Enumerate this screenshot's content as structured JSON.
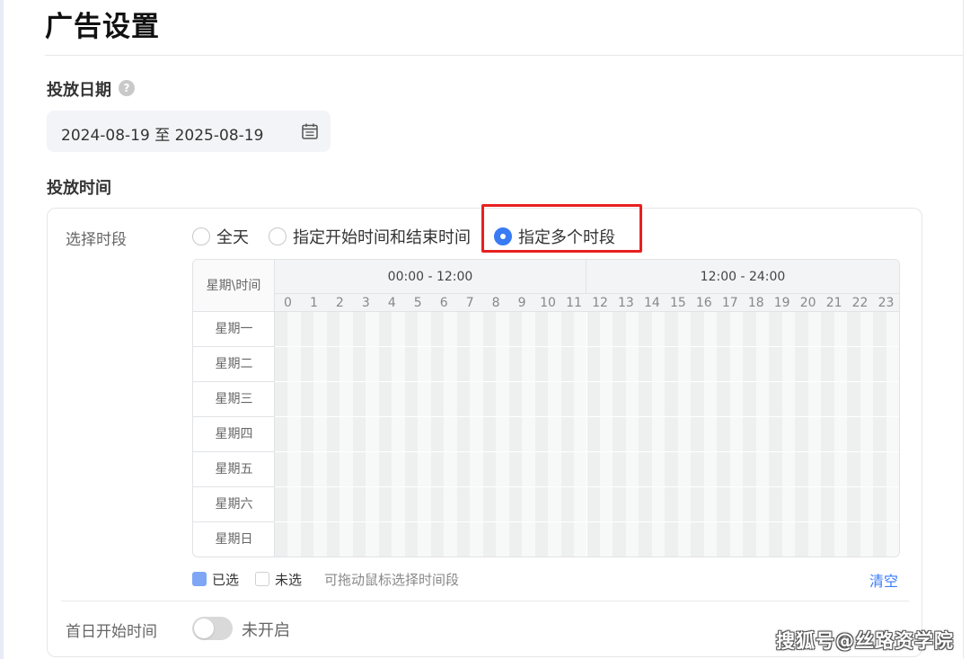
{
  "page": {
    "title": "广告设置"
  },
  "delivery_date": {
    "label": "投放日期",
    "help_icon": "question-icon",
    "help_glyph": "?",
    "range_value": "2024-08-19 至 2025-08-19",
    "calendar_icon": "calendar-icon"
  },
  "delivery_time": {
    "label": "投放时间",
    "select_period_label": "选择时段",
    "options": [
      {
        "label": "全天",
        "checked": false
      },
      {
        "label": "指定开始时间和结束时间",
        "checked": false
      },
      {
        "label": "指定多个时段",
        "checked": true
      }
    ],
    "highlight_color": "#e82020",
    "accent_color": "#3a7bf5"
  },
  "schedule_grid": {
    "corner_label": "星期\\时间",
    "half_labels": [
      "00:00 - 12:00",
      "12:00 - 24:00"
    ],
    "hours": [
      "0",
      "1",
      "2",
      "3",
      "4",
      "5",
      "6",
      "7",
      "8",
      "9",
      "10",
      "11",
      "12",
      "13",
      "14",
      "15",
      "16",
      "17",
      "18",
      "19",
      "20",
      "21",
      "22",
      "23"
    ],
    "days": [
      "星期一",
      "星期二",
      "星期三",
      "星期四",
      "星期五",
      "星期六",
      "星期日"
    ],
    "selected_slots": 0
  },
  "legend": {
    "selected_label": "已选",
    "unselected_label": "未选",
    "hint": "可拖动鼠标选择时间段",
    "clear_label": "清空",
    "selected_color": "#7ea6f5"
  },
  "first_day": {
    "label": "首日开始时间",
    "toggle_on": false,
    "toggle_text": "未开启"
  },
  "watermark": {
    "text": "搜狐号@丝路资学院"
  }
}
